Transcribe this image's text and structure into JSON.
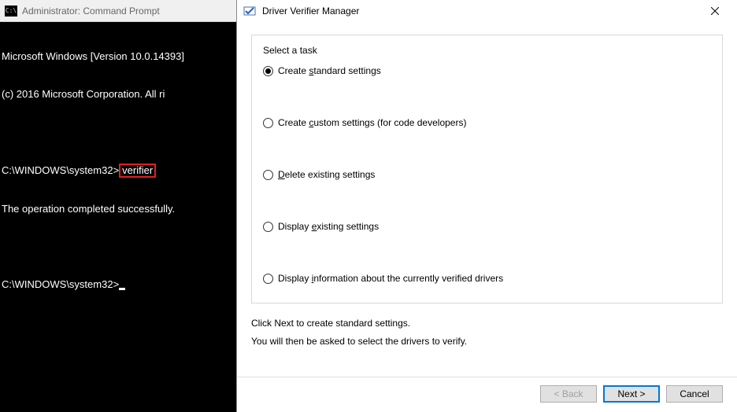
{
  "cmd": {
    "title": "Administrator: Command Prompt",
    "line1": "Microsoft Windows [Version 10.0.14393]",
    "line2": "(c) 2016 Microsoft Corporation. All ri",
    "prompt1_prefix": "C:\\WINDOWS\\system32>",
    "prompt1_cmd": "verifier",
    "result": "The operation completed successfully.",
    "prompt2": "C:\\WINDOWS\\system32>"
  },
  "dialog": {
    "title": "Driver Verifier Manager",
    "task_label": "Select a task",
    "options": {
      "o1_pre": "Create ",
      "o1_u": "s",
      "o1_post": "tandard settings",
      "o2_pre": "Create ",
      "o2_u": "c",
      "o2_post": "ustom settings (for code developers)",
      "o3_pre": "",
      "o3_u": "D",
      "o3_post": "elete existing settings",
      "o4_pre": "Display ",
      "o4_u": "e",
      "o4_post": "xisting settings",
      "o5_pre": "Display ",
      "o5_u": "i",
      "o5_post": "nformation about the currently verified drivers"
    },
    "selected": 0,
    "instruction1": "Click Next to create standard settings.",
    "instruction2": "You will then be asked to select the drivers to verify.",
    "buttons": {
      "back": "< Back",
      "next": "Next >",
      "cancel": "Cancel"
    }
  }
}
